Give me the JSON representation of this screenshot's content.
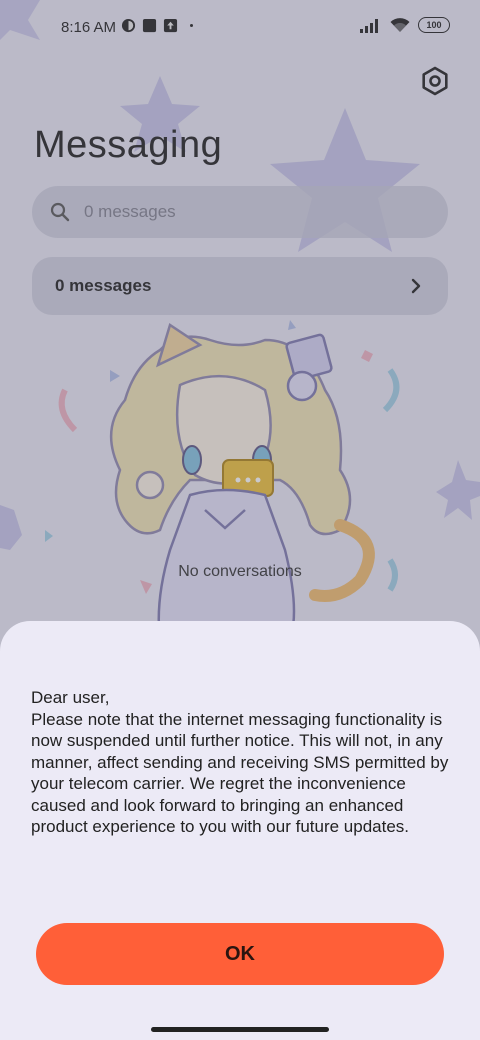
{
  "status_bar": {
    "time": "8:16 AM",
    "battery": "100",
    "icons": [
      "app-notification-icon",
      "square-notification-icon",
      "upload-notification-icon",
      "dot-icon",
      "signal-icon",
      "wifi-icon",
      "battery-icon"
    ]
  },
  "header": {
    "title": "Messaging",
    "settings_icon": "gear-icon"
  },
  "search": {
    "placeholder": "0 messages"
  },
  "messages_row": {
    "label": "0 messages"
  },
  "empty_state": {
    "text": "No conversations"
  },
  "dialog": {
    "notice_lines": [
      "Dear user,",
      "Please note that the internet messaging functionality is now suspended until further notice. This will not, in any manner, affect sending and receiving SMS permitted by your telecom carrier. We regret the inconvenience caused and look forward to bringing an enhanced product experience to you with our future updates."
    ],
    "ok_label": "OK"
  },
  "colors": {
    "accent": "#ff5f38",
    "sheet_bg": "#eceaf6",
    "star": "#c9c6ea"
  }
}
